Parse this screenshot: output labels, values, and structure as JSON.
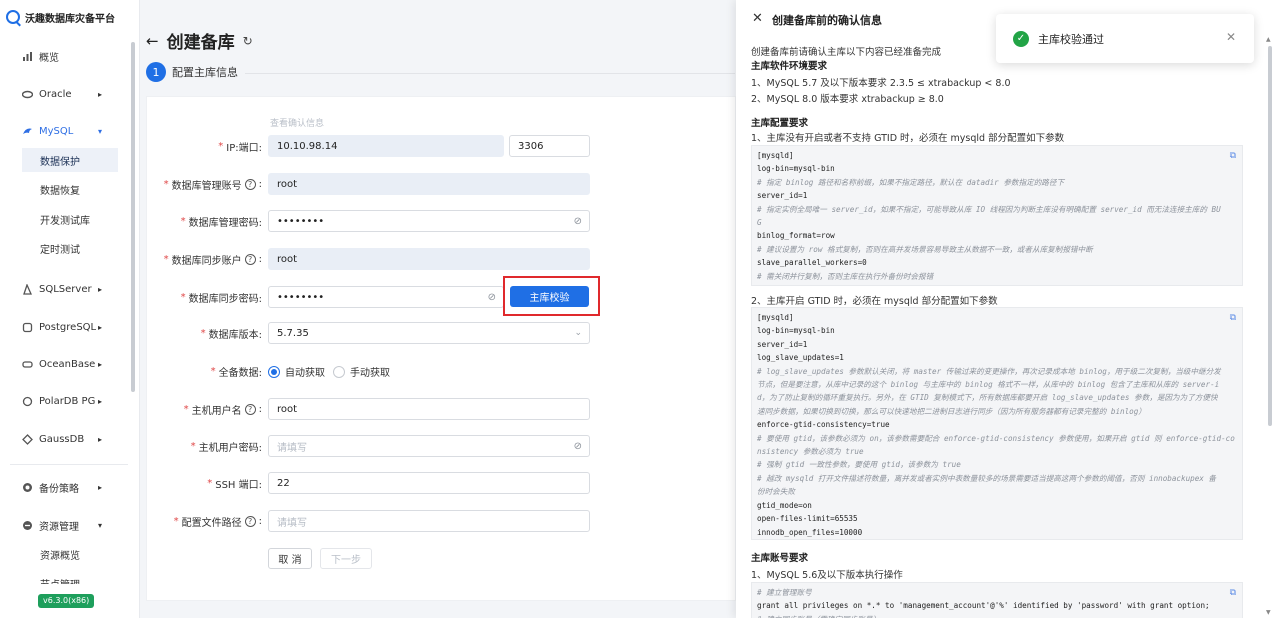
{
  "app": {
    "brand": "沃趣数据库灾备平台",
    "version": "v6.3.0(x86)"
  },
  "sidebar": {
    "items": [
      {
        "label": "概览",
        "icon": "bar-chart-icon"
      },
      {
        "label": "Oracle",
        "icon": "database-icon",
        "arrow": "▸"
      },
      {
        "label": "MySQL",
        "icon": "dolphin-icon",
        "arrow": "▾"
      },
      {
        "label": "SQLServer",
        "icon": "sqlserver-icon",
        "arrow": "▸"
      },
      {
        "label": "PostgreSQL",
        "icon": "postgresql-icon",
        "arrow": "▸"
      },
      {
        "label": "OceanBase",
        "icon": "oceanbase-icon",
        "arrow": "▸"
      },
      {
        "label": "PolarDB PG",
        "icon": "polardb-icon",
        "arrow": "▸"
      },
      {
        "label": "GaussDB",
        "icon": "gaussdb-icon",
        "arrow": "▸"
      },
      {
        "label": "备份策略",
        "icon": "backup-policy-icon",
        "arrow": "▸"
      },
      {
        "label": "资源管理",
        "icon": "resource-icon",
        "arrow": "▾"
      }
    ],
    "mysql_sub": [
      "数据保护",
      "数据恢复",
      "开发测试库",
      "定时测试"
    ],
    "resource_sub": [
      "资源概览",
      "节点管理"
    ]
  },
  "page": {
    "title": "创建备库",
    "step_number": "1",
    "step_label": "配置主库信息",
    "view_confirm_link": "查看确认信息"
  },
  "form": {
    "ip_label": "IP:端口:",
    "ip_value": "10.10.98.14",
    "port_value": "3306",
    "admin_user_label": "数据库管理账号",
    "admin_user_value": "root",
    "admin_pwd_label": "数据库管理密码:",
    "admin_pwd_value": "••••••••",
    "sync_user_label": "数据库同步账户",
    "sync_user_value": "root",
    "sync_pwd_label": "数据库同步密码:",
    "sync_pwd_value": "••••••••",
    "verify_button": "主库校验",
    "db_version_label": "数据库版本:",
    "db_version_value": "5.7.35",
    "full_backup_label": "全备数据:",
    "radio_auto": "自动获取",
    "radio_manual": "手动获取",
    "radio_selected": "auto",
    "host_user_label": "主机用户名",
    "host_user_value": "root",
    "host_pwd_label": "主机用户密码:",
    "host_pwd_placeholder": "请填写",
    "ssh_port_label": "SSH 端口:",
    "ssh_port_value": "22",
    "config_path_label": "配置文件路径",
    "config_path_placeholder": "请填写",
    "cancel_button": "取 消",
    "next_button": "下一步"
  },
  "panel": {
    "title": "创建备库前的确认信息",
    "intro": "创建备库前请确认主库以下内容已经准备完成",
    "software_heading": "主库软件环境要求",
    "software_1": "1、MySQL 5.7 及以下版本要求 2.3.5 ≤ xtrabackup < 8.0",
    "software_2": "2、MySQL 8.0 版本要求 xtrabackup ≥ 8.0",
    "config_heading": "主库配置要求",
    "config_1": "1、主库没有开启或者不支持 GTID 时，必须在 mysqld 部分配置如下参数",
    "code1": [
      {
        "t": "[mysqld]"
      },
      {
        "t": "log-bin=mysql-bin"
      },
      {
        "t": "# 指定 binlog 路径和名称前缀，如果不指定路径，默认在 datadir 参数指定的路径下",
        "c": true
      },
      {
        "t": "server_id=1"
      },
      {
        "t": "# 指定实例全局唯一 server_id，如果不指定，可能导致从库 IO 线程因为判断主库没有明确配置 server_id 而无法连接主库的 BU",
        "c": true
      },
      {
        "t": "G",
        "c": true
      },
      {
        "t": "binlog_format=row"
      },
      {
        "t": "# 建议设置为 row 格式复制，否则在高并发场景容易导致主从数据不一致，或者从库复制报错中断",
        "c": true
      },
      {
        "t": "slave_parallel_workers=0"
      },
      {
        "t": "# 需关闭并行复制，否则主库在执行外备份时会报错",
        "c": true
      }
    ],
    "config_2": "2、主库开启 GTID 时，必须在 mysqld 部分配置如下参数",
    "code2": [
      {
        "t": "[mysqld]"
      },
      {
        "t": "log-bin=mysql-bin"
      },
      {
        "t": "server_id=1"
      },
      {
        "t": "log_slave_updates=1"
      },
      {
        "t": "# log_slave_updates 参数默认关闭，将 master 传输过来的变更操作，再次记录成本地 binlog，用于级二次复制，当级中继分发",
        "c": true
      },
      {
        "t": "节点，但是要注意，从库中记录的这个 binlog 与主库中的 binlog 格式不一样，从库中的 binlog 包含了主库和从库的 server-i",
        "c": true
      },
      {
        "t": "d，为了防止复制的循环重复执行。另外，在 GTID 复制模式下，所有数据库都要开启 log_slave_updates 参数，是因为为了方便快",
        "c": true
      },
      {
        "t": "速同步数据，如果切换到切换，那么可以快速地把二进制日志进行同步（因为所有服务器都有记录完整的 binlog）",
        "c": true
      },
      {
        "t": "enforce-gtid-consistency=true"
      },
      {
        "t": "# 要使用 gtid，该参数必须为 on，该参数需要配合 enforce-gtid-consistency 参数使用，如果开启 gtid 则 enforce-gtid-co",
        "c": true
      },
      {
        "t": "nsistency 参数必须为 true",
        "c": true
      },
      {
        "t": "# 强制 gtid 一致性参数，要使用 gtid，该参数为 true",
        "c": true
      },
      {
        "t": "# 越改 mysqld 打开文件描述符数量，离并发或者实例中表数量较多的场景需要适当提高这两个参数的阈值，否则 innobackupex 备",
        "c": true
      },
      {
        "t": "份时会失败",
        "c": true
      },
      {
        "t": "gtid_mode=on"
      },
      {
        "t": "open-files-limit=65535"
      },
      {
        "t": "innodb_open_files=10000"
      }
    ],
    "account_heading": "主库账号要求",
    "account_1": "1、MySQL 5.6及以下版本执行操作",
    "code3": [
      {
        "t": "# 建立管理账号",
        "c": true
      },
      {
        "t": "grant all privileges on *.* to 'management_account'@'%' identified by 'password' with grant option;"
      },
      {
        "t": "# 建立同步账号（需确定同步账号）",
        "c": true
      }
    ]
  },
  "toast": {
    "message": "主库校验通过"
  },
  "colors": {
    "primary": "#1f6fe5",
    "success": "#22a446",
    "highlight": "#e0292c"
  }
}
